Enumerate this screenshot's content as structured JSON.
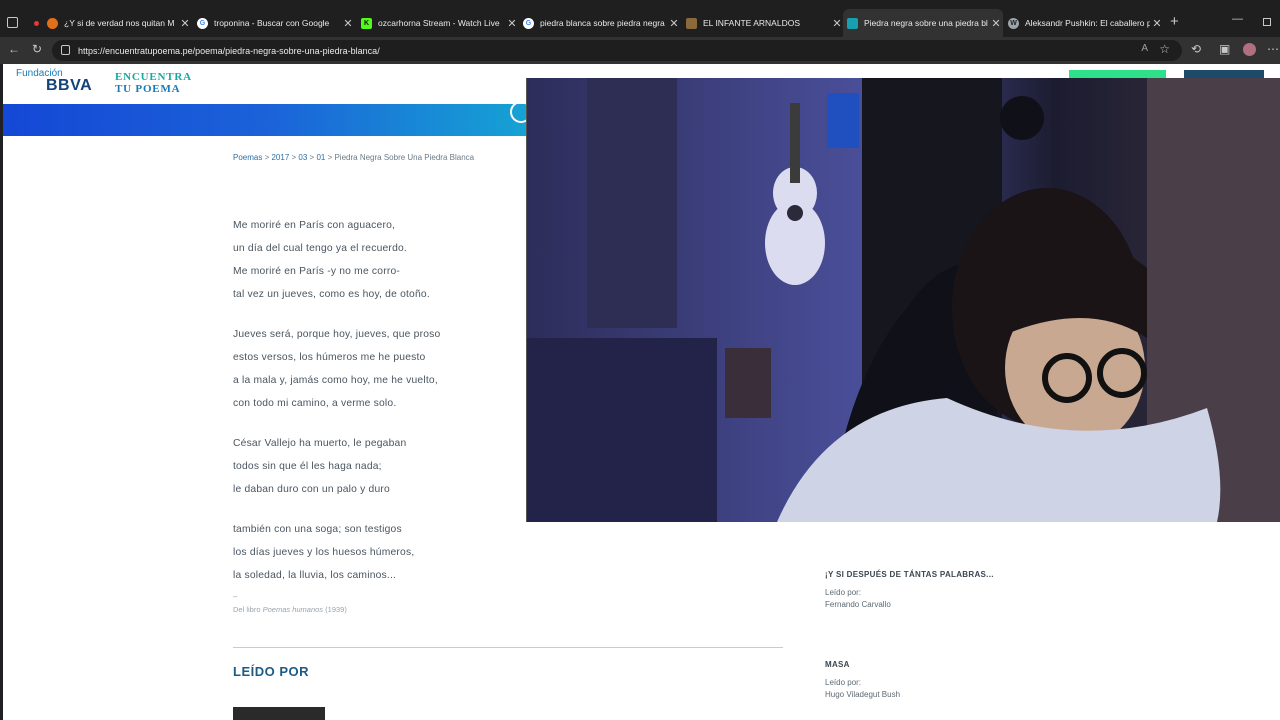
{
  "browser": {
    "tabs": [
      {
        "title": "¿Y si de verdad nos quitan M",
        "favicon": "youtube-icon",
        "color": "#e03a3a"
      },
      {
        "title": "troponina - Buscar con Google",
        "favicon": "google-icon",
        "color": "#ffffff"
      },
      {
        "title": "ozcarhorna Stream - Watch Live",
        "favicon": "kick-icon",
        "color": "#53fc18"
      },
      {
        "title": "piedra blanca sobre piedra negra",
        "favicon": "google-icon",
        "color": "#ffffff"
      },
      {
        "title": "EL INFANTE ARNALDOS",
        "favicon": "site-icon",
        "color": "#8a6a3a"
      },
      {
        "title": "Piedra negra sobre una piedra bl",
        "favicon": "site-icon",
        "color": "#18a0b0"
      },
      {
        "title": "Aleksandr Pushkin: El caballero p",
        "favicon": "wordpress-icon",
        "color": "#9aa4ac"
      }
    ],
    "url": "https://encuentratupoema.pe/poema/piedra-negra-sobre-una-piedra-blanca/"
  },
  "site": {
    "logo_top": "Fundación",
    "logo_bottom": "BBVA",
    "brand_line1": "ENCUENTRA",
    "brand_line2": "TU POEMA"
  },
  "breadcrumb": {
    "items": [
      "Poemas",
      "2017",
      "03",
      "01"
    ],
    "current": "Piedra Negra Sobre Una Piedra Blanca"
  },
  "poem": {
    "stanzas": [
      [
        "Me moriré en París con aguacero,",
        "un día del cual tengo ya el recuerdo.",
        "Me moriré en París -y no me corro-",
        "tal vez un jueves, como es hoy, de otoño."
      ],
      [
        "Jueves será, porque hoy, jueves, que proso",
        "estos versos, los húmeros me he puesto",
        "a la mala y, jamás como hoy, me he vuelto,",
        "con todo mi camino, a verme solo."
      ],
      [
        "César Vallejo ha muerto, le pegaban",
        "todos sin que él les haga nada;",
        "le daban duro con un palo y duro"
      ],
      [
        "también con una soga; son testigos",
        "los días jueves y los huesos húmeros,",
        "la soledad, la lluvia, los caminos..."
      ]
    ],
    "dash": "–",
    "book_prefix": "Del libro",
    "book_title": "Poemas humanos",
    "book_year": "(1939)"
  },
  "read_by_heading": "LEÍDO POR",
  "sidebar_items": [
    {
      "title": "¡Y SI DESPUÉS DE TÁNTAS PALABRAS...",
      "label": "Leído por:",
      "reader": "Fernando Carvallo"
    },
    {
      "title": "MASA",
      "label": "Leído por:",
      "reader": "Hugo Viladegut Bush"
    }
  ]
}
